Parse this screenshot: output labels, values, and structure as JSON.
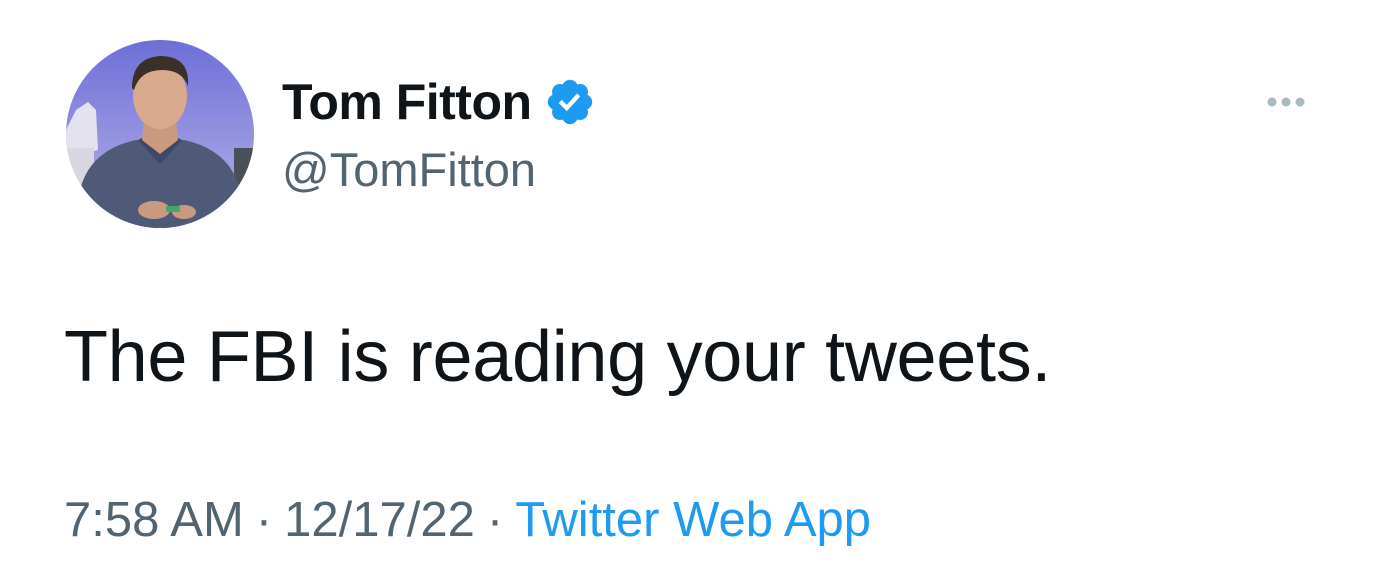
{
  "tweet": {
    "author": {
      "display_name": "Tom Fitton",
      "handle": "@TomFitton",
      "verified": true,
      "avatar_icon": "profile-photo"
    },
    "text": "The FBI is reading your tweets.",
    "time": "7:58 AM",
    "separator": "·",
    "date": "12/17/22",
    "source": "Twitter Web App",
    "more_icon": "more-horizontal-icon"
  },
  "colors": {
    "text_primary": "#0f1419",
    "text_secondary": "#536471",
    "link_blue": "#1d9bf0",
    "verified_blue": "#1d9bf0",
    "more_icon_gray": "#aab8c2"
  }
}
